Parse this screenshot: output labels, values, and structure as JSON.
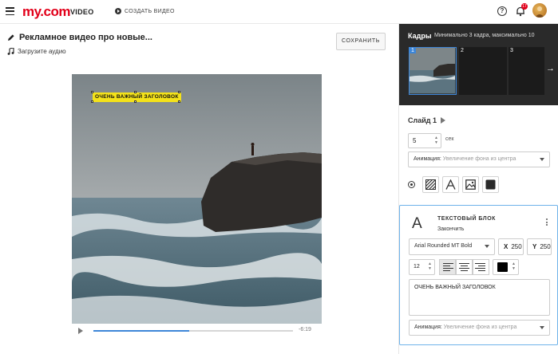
{
  "header": {
    "logo_text": "my.com",
    "section": "VIDEO",
    "create_video": "СОЗДАТЬ ВИДЕО",
    "notification_count": "17",
    "icons": [
      "menu-icon",
      "play-circle-icon",
      "help-icon",
      "bell-icon",
      "avatar"
    ]
  },
  "editor": {
    "video_title": "Рекламное видео про новые...",
    "upload_audio": "Загрузите аудио",
    "save_label": "СОХРАНИТЬ"
  },
  "preview": {
    "overlay_text": "ОЧЕНЬ ВАЖНЫЙ ЗАГОЛОВОК",
    "time_remaining": "-6:19",
    "progress": 0.48
  },
  "frames": {
    "title": "Кадры",
    "subtitle": "Минимально 3 кадра, максимально 10",
    "items": [
      {
        "number": "1",
        "active": true
      },
      {
        "number": "2",
        "active": false
      },
      {
        "number": "3",
        "active": false
      }
    ]
  },
  "slide": {
    "title": "Слайд 1",
    "duration": "5",
    "duration_unit": "сек",
    "animation_label": "Анимация:",
    "animation_value": "Увеличение фона из центра",
    "tools": [
      "pattern-icon",
      "text-icon",
      "image-icon",
      "color-fill-icon"
    ]
  },
  "text_block": {
    "icon_letter": "A",
    "title": "ТЕКСТОВЫЙ БЛОК",
    "finish_label": "Закончить",
    "font": "Arial Rounded MT Bold",
    "x_label": "X",
    "x_value": "250",
    "y_label": "Y",
    "y_value": "250",
    "font_size": "12",
    "alignment_active": "left",
    "color": "#000000",
    "text": "ОЧЕНЬ ВАЖНЫЙ ЗАГОЛОВОК",
    "animation_label": "Анимация:",
    "animation_value": "Увеличение фона из центра"
  },
  "colors": {
    "brand": "#e2001a",
    "accent": "#3d86d8",
    "highlight": "#f4e21a",
    "panel_dark": "#2a2a2a"
  }
}
